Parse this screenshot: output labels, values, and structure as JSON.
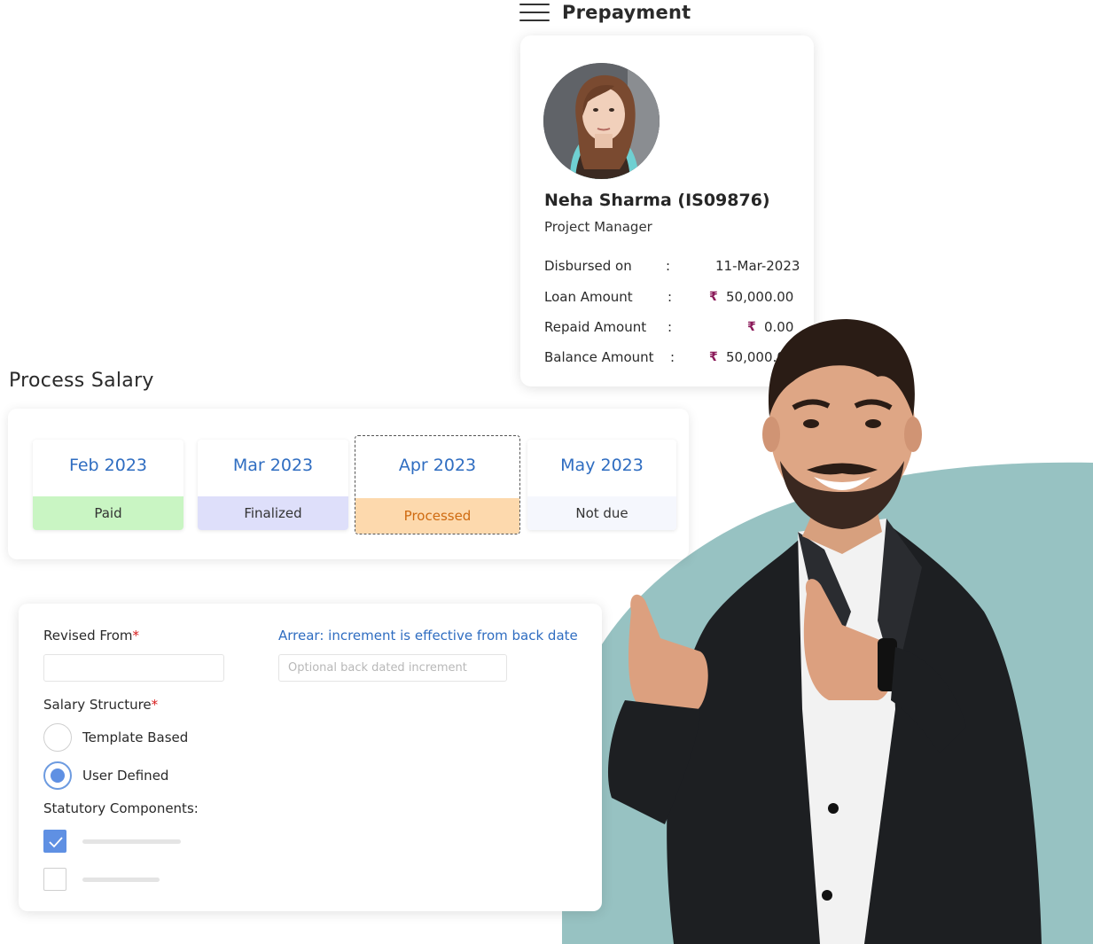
{
  "prepayment": {
    "title": "Prepayment",
    "employee": {
      "name": "Neha Sharma (IS09876)",
      "role": "Project Manager",
      "rows": [
        {
          "label": "Disbursed on",
          "currency": "",
          "value": "11-Mar-2023"
        },
        {
          "label": "Loan Amount",
          "currency": "₹",
          "value": "50,000.00"
        },
        {
          "label": "Repaid Amount",
          "currency": "₹",
          "value": "0.00"
        },
        {
          "label": "Balance Amount",
          "currency": "₹",
          "value": "50,000.0"
        }
      ],
      "colon": ":"
    }
  },
  "process_salary": {
    "title": "Process Salary",
    "months": [
      {
        "label": "Feb 2023",
        "status": "Paid",
        "color": "#c9f5c3"
      },
      {
        "label": "Mar 2023",
        "status": "Finalized",
        "color": "#dedffa"
      },
      {
        "label": "Apr 2023",
        "status": "Processed",
        "color": "#fdd9ad",
        "status_color": "#cf6a10",
        "selected": true
      },
      {
        "label": "May 2023",
        "status": "Not due",
        "color": "#f5f7fd"
      }
    ]
  },
  "form": {
    "revised_from_label": "Revised From",
    "revised_from_value": "",
    "required_mark": "*",
    "arrear_label": "Arrear: increment is effective from back date",
    "arrear_placeholder": "Optional back dated increment",
    "salary_structure_label": "Salary Structure",
    "options": [
      {
        "label": "Template Based",
        "selected": false
      },
      {
        "label": "User Defined",
        "selected": true
      }
    ],
    "statutory_label": "Statutory Components:",
    "statutory_items": [
      {
        "checked": true
      },
      {
        "checked": false
      }
    ]
  },
  "colors": {
    "accent_blue": "#2f6dc1",
    "control_blue": "#5f90e3",
    "rupee": "#8b1a5a",
    "teal_shape": "#97c2c2"
  }
}
